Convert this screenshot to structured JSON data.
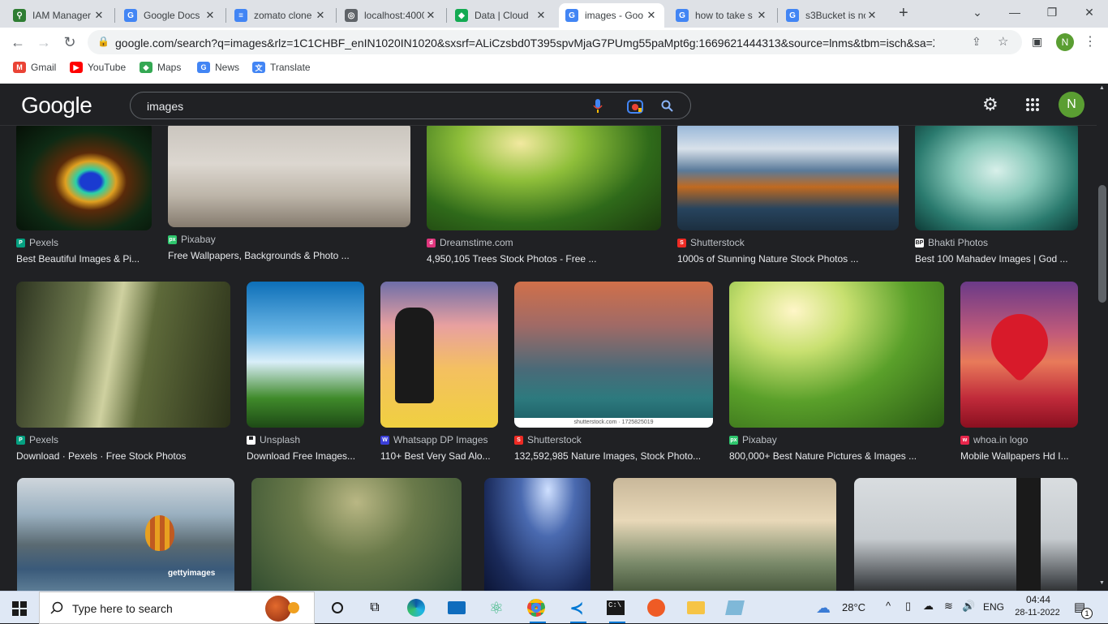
{
  "tabs": [
    {
      "title": "IAM Manager",
      "fav": "key-icon",
      "color": "#2e7d32",
      "glyph": "⚲"
    },
    {
      "title": "Google Docs",
      "fav": "google-icon",
      "color": "#4285f4",
      "glyph": "G"
    },
    {
      "title": "zomato clone",
      "fav": "docs-icon",
      "color": "#4285f4",
      "glyph": "≡"
    },
    {
      "title": "localhost:4000",
      "fav": "globe-icon",
      "color": "#5f6368",
      "glyph": "◎"
    },
    {
      "title": "Data | Cloud",
      "fav": "mongodb-leaf-icon",
      "color": "#13aa52",
      "glyph": "◆"
    },
    {
      "title": "images - Goo",
      "fav": "google-icon",
      "color": "#4285f4",
      "glyph": "G"
    },
    {
      "title": "how to take s",
      "fav": "google-icon",
      "color": "#4285f4",
      "glyph": "G"
    },
    {
      "title": "s3Bucket is no",
      "fav": "google-icon",
      "color": "#4285f4",
      "glyph": "G"
    }
  ],
  "active_tab": 5,
  "url": "google.com/search?q=images&rlz=1C1CHBF_enIN1020IN1020&sxsrf=ALiCzsbd0T395spvMjaG7PUmg55paMpt6g:1669621444313&source=lnms&tbm=isch&sa=X&ve...",
  "profile_initial": "N",
  "bookmarks": [
    {
      "label": "Gmail",
      "icon": "gmail-icon",
      "color": "#ea4335",
      "glyph": "M"
    },
    {
      "label": "YouTube",
      "icon": "youtube-icon",
      "color": "#ff0000",
      "glyph": "▶"
    },
    {
      "label": "Maps",
      "icon": "maps-icon",
      "color": "#34a853",
      "glyph": "◆"
    },
    {
      "label": "News",
      "icon": "news-icon",
      "color": "#4285f4",
      "glyph": "G"
    },
    {
      "label": "Translate",
      "icon": "translate-icon",
      "color": "#4285f4",
      "glyph": "文"
    }
  ],
  "google": {
    "logo": "Google",
    "query": "images",
    "avatar": "N"
  },
  "results": [
    {
      "source": "Pexels",
      "caption": "Best Beautiful Images & Pi...",
      "src_color": "#05a081",
      "src_glyph": "P"
    },
    {
      "source": "Pixabay",
      "caption": "Free Wallpapers, Backgrounds & Photo ...",
      "src_color": "#2ec66d",
      "src_glyph": "px"
    },
    {
      "source": "Dreamstime.com",
      "caption": "4,950,105 Trees Stock Photos - Free ...",
      "src_color": "#e0357d",
      "src_glyph": "d"
    },
    {
      "source": "Shutterstock",
      "caption": "1000s of Stunning Nature Stock Photos ...",
      "src_color": "#ee2b24",
      "src_glyph": "S"
    },
    {
      "source": "Bhakti Photos",
      "caption": "Best 100 Mahadev Images | God ...",
      "src_color": "#ffffff",
      "src_glyph": "BP"
    },
    {
      "source": "Pexels",
      "caption": "Download · Pexels · Free Stock Photos",
      "src_color": "#05a081",
      "src_glyph": "P"
    },
    {
      "source": "Unsplash",
      "caption": "Download Free Images...",
      "src_color": "#ffffff",
      "src_glyph": "▀"
    },
    {
      "source": "Whatsapp DP Images",
      "caption": "110+ Best Very Sad Alo...",
      "src_color": "#3b3fd8",
      "src_glyph": "W"
    },
    {
      "source": "Shutterstock",
      "caption": "132,592,985 Nature Images, Stock Photo...",
      "src_color": "#ee2b24",
      "src_glyph": "S"
    },
    {
      "source": "Pixabay",
      "caption": "800,000+ Best Nature Pictures & Images ...",
      "src_color": "#2ec66d",
      "src_glyph": "px"
    },
    {
      "source": "whoa.in logo",
      "caption": "Mobile Wallpapers Hd I...",
      "src_color": "#e8264b",
      "src_glyph": "w"
    }
  ],
  "image_texts": {
    "shutterstock": "shutterstock.com · 1725825019",
    "getty": "gettyimages"
  },
  "taskbar": {
    "search_placeholder": "Type here to search",
    "temperature": "28°C",
    "language": "ENG",
    "time": "04:44",
    "date": "28-11-2022",
    "notif_count": "1"
  }
}
